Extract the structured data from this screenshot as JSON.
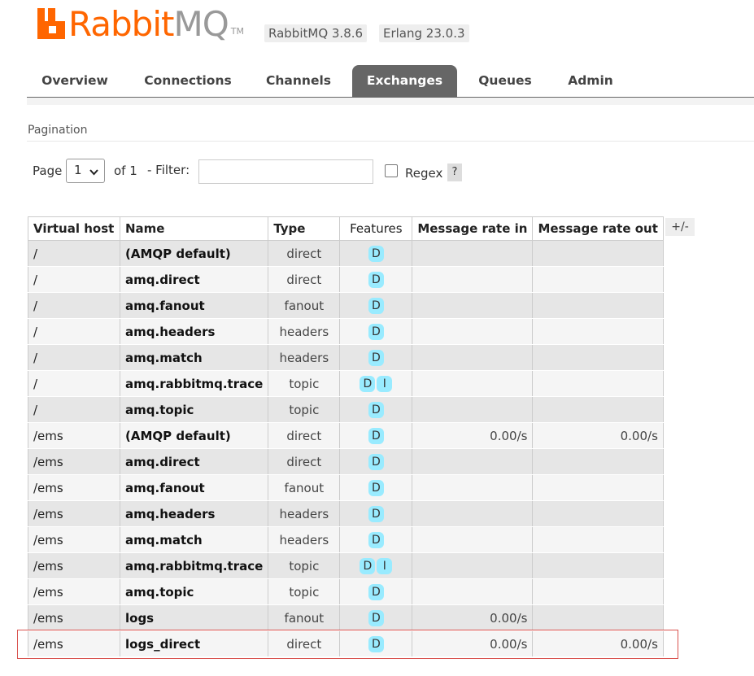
{
  "brand": {
    "logo_name": "RabbitMQ",
    "logo_part1": "Rabbit",
    "logo_part2": "MQ",
    "logo_tm": "TM",
    "version": "RabbitMQ 3.8.6",
    "erlang": "Erlang 23.0.3",
    "accent": "#ff6600"
  },
  "nav": {
    "tabs": [
      "Overview",
      "Connections",
      "Channels",
      "Exchanges",
      "Queues",
      "Admin"
    ],
    "active": "Exchanges"
  },
  "pagination": {
    "title": "Pagination",
    "page_label": "Page",
    "page_value": "1",
    "of_label": "of 1",
    "filter_label": "- Filter:",
    "filter_value": "",
    "regex_label": "Regex",
    "regex_checked": false,
    "help_label": "?"
  },
  "table": {
    "columns": [
      "Virtual host",
      "Name",
      "Type",
      "Features",
      "Message rate in",
      "Message rate out"
    ],
    "toggle_label": "+/-",
    "rows": [
      {
        "vhost": "/",
        "name": "(AMQP default)",
        "type": "direct",
        "features": [
          "D"
        ],
        "rate_in": "",
        "rate_out": ""
      },
      {
        "vhost": "/",
        "name": "amq.direct",
        "type": "direct",
        "features": [
          "D"
        ],
        "rate_in": "",
        "rate_out": ""
      },
      {
        "vhost": "/",
        "name": "amq.fanout",
        "type": "fanout",
        "features": [
          "D"
        ],
        "rate_in": "",
        "rate_out": ""
      },
      {
        "vhost": "/",
        "name": "amq.headers",
        "type": "headers",
        "features": [
          "D"
        ],
        "rate_in": "",
        "rate_out": ""
      },
      {
        "vhost": "/",
        "name": "amq.match",
        "type": "headers",
        "features": [
          "D"
        ],
        "rate_in": "",
        "rate_out": ""
      },
      {
        "vhost": "/",
        "name": "amq.rabbitmq.trace",
        "type": "topic",
        "features": [
          "D",
          "I"
        ],
        "rate_in": "",
        "rate_out": ""
      },
      {
        "vhost": "/",
        "name": "amq.topic",
        "type": "topic",
        "features": [
          "D"
        ],
        "rate_in": "",
        "rate_out": ""
      },
      {
        "vhost": "/ems",
        "name": "(AMQP default)",
        "type": "direct",
        "features": [
          "D"
        ],
        "rate_in": "0.00/s",
        "rate_out": "0.00/s"
      },
      {
        "vhost": "/ems",
        "name": "amq.direct",
        "type": "direct",
        "features": [
          "D"
        ],
        "rate_in": "",
        "rate_out": ""
      },
      {
        "vhost": "/ems",
        "name": "amq.fanout",
        "type": "fanout",
        "features": [
          "D"
        ],
        "rate_in": "",
        "rate_out": ""
      },
      {
        "vhost": "/ems",
        "name": "amq.headers",
        "type": "headers",
        "features": [
          "D"
        ],
        "rate_in": "",
        "rate_out": ""
      },
      {
        "vhost": "/ems",
        "name": "amq.match",
        "type": "headers",
        "features": [
          "D"
        ],
        "rate_in": "",
        "rate_out": ""
      },
      {
        "vhost": "/ems",
        "name": "amq.rabbitmq.trace",
        "type": "topic",
        "features": [
          "D",
          "I"
        ],
        "rate_in": "",
        "rate_out": ""
      },
      {
        "vhost": "/ems",
        "name": "amq.topic",
        "type": "topic",
        "features": [
          "D"
        ],
        "rate_in": "",
        "rate_out": ""
      },
      {
        "vhost": "/ems",
        "name": "logs",
        "type": "fanout",
        "features": [
          "D"
        ],
        "rate_in": "0.00/s",
        "rate_out": ""
      },
      {
        "vhost": "/ems",
        "name": "logs_direct",
        "type": "direct",
        "features": [
          "D"
        ],
        "rate_in": "0.00/s",
        "rate_out": "0.00/s"
      }
    ]
  }
}
